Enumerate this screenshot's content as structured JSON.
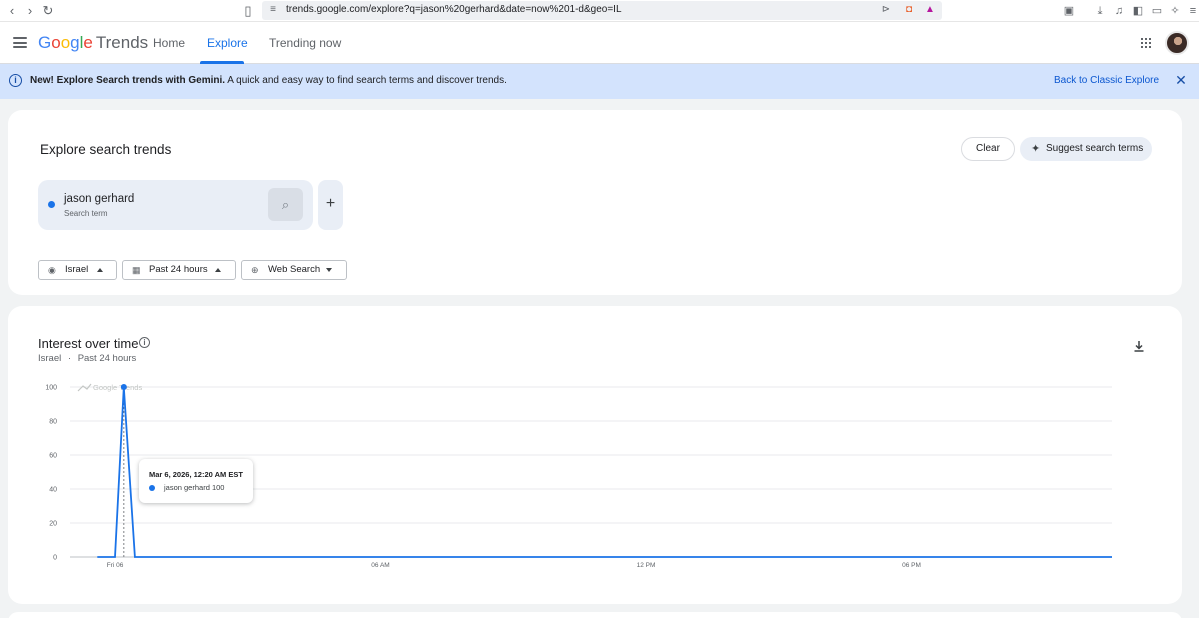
{
  "browser": {
    "url": "trends.google.com/explore?q=jason%20gerhard&date=now%201-d&geo=IL"
  },
  "header": {
    "logo_google": [
      "G",
      "o",
      "o",
      "g",
      "l",
      "e"
    ],
    "logo_product": "Trends",
    "tabs": [
      {
        "label": "Home",
        "active": false
      },
      {
        "label": "Explore",
        "active": true
      },
      {
        "label": "Trending now",
        "active": false
      }
    ]
  },
  "banner": {
    "bold": "New! Explore Search trends with Gemini.",
    "text": " A quick and easy way to find search terms and discover trends.",
    "link": "Back to Classic Explore"
  },
  "explore": {
    "title": "Explore search trends",
    "clear_label": "Clear",
    "suggest_label": "Suggest search terms",
    "term": {
      "name": "jason gerhard",
      "type": "Search term",
      "color": "#1a73e8"
    },
    "filters": {
      "region": "Israel",
      "time": "Past 24 hours",
      "property": "Web Search"
    }
  },
  "interest": {
    "title": "Interest over time",
    "region": "Israel",
    "separator": "·",
    "time": "Past 24 hours",
    "watermark": "Google Trends",
    "tooltip": {
      "date": "Mar 6, 2026, 12:20 AM EST",
      "term": "jason gerhard",
      "value": "100"
    }
  },
  "chart_data": {
    "type": "line",
    "title": "",
    "xlabel": "",
    "ylabel": "",
    "ylim": [
      0,
      100
    ],
    "yticks": [
      0,
      20,
      40,
      60,
      80,
      100
    ],
    "xticks": [
      {
        "label": "Fri 06",
        "hour": 0
      },
      {
        "label": "06 AM",
        "hour": 6
      },
      {
        "label": "12 PM",
        "hour": 12
      },
      {
        "label": "06 PM",
        "hour": 18
      }
    ],
    "x_hours": [
      -0.4,
      0,
      0.2,
      0.45,
      1,
      23.3
    ],
    "series": [
      {
        "name": "jason gerhard",
        "color": "#1a73e8",
        "values": [
          0,
          0,
          100,
          0,
          0,
          0
        ]
      }
    ],
    "grid": true
  }
}
